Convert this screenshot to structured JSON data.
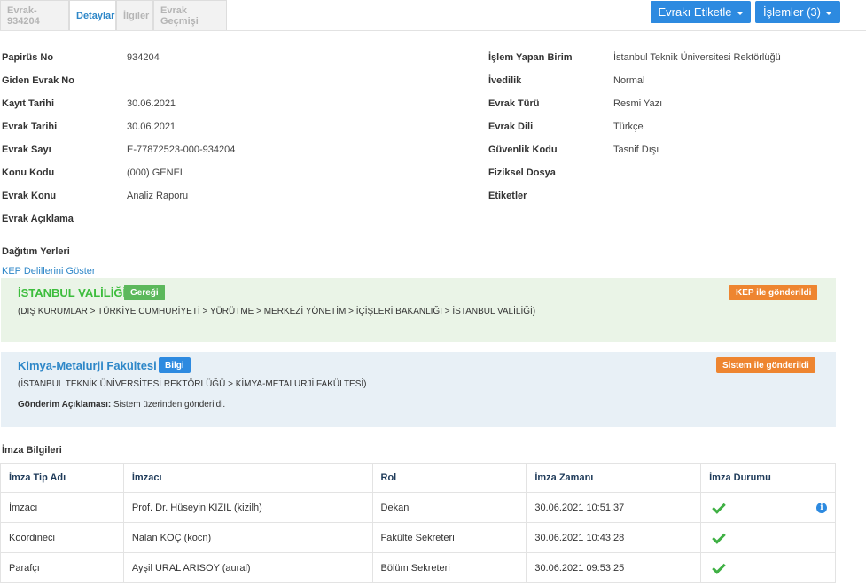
{
  "tabs": [
    "Evrak-934204",
    "Detaylar",
    "İlgiler",
    "Evrak Geçmişi"
  ],
  "buttons": {
    "tag": "Evrakı Etiketle",
    "actions": "İşlemler (3)"
  },
  "details_left": [
    {
      "label": "Papirüs No",
      "value": "934204"
    },
    {
      "label": "Giden Evrak No",
      "value": ""
    },
    {
      "label": "Kayıt Tarihi",
      "value": "30.06.2021"
    },
    {
      "label": "Evrak Tarihi",
      "value": "30.06.2021"
    },
    {
      "label": "Evrak Sayı",
      "value": "E-77872523-000-934204"
    },
    {
      "label": "Konu Kodu",
      "value": "(000) GENEL"
    },
    {
      "label": "Evrak Konu",
      "value": "Analiz Raporu"
    },
    {
      "label": "Evrak Açıklama",
      "value": ""
    }
  ],
  "details_right": [
    {
      "label": "İşlem Yapan Birim",
      "value": "İstanbul Teknik Üniversitesi Rektörlüğü"
    },
    {
      "label": "İvedilik",
      "value": "Normal"
    },
    {
      "label": "Evrak Türü",
      "value": "Resmi Yazı"
    },
    {
      "label": "Evrak Dili",
      "value": "Türkçe"
    },
    {
      "label": "Güvenlik Kodu",
      "value": "Tasnif Dışı"
    },
    {
      "label": "Fiziksel Dosya",
      "value": ""
    },
    {
      "label": "Etiketler",
      "value": ""
    }
  ],
  "distribution": {
    "title": "Dağıtım Yerleri",
    "kep_link": "KEP Delillerini Göster",
    "items": [
      {
        "name": "İSTANBUL VALİLİĞİ",
        "type_badge": "Gereği",
        "status_badge": "KEP ile gönderildi",
        "path": "(DIŞ KURUMLAR > TÜRKİYE CUMHURİYETİ > YÜRÜTME > MERKEZİ YÖNETİM > İÇİŞLERİ BAKANLIĞI > İSTANBUL VALİLİĞİ)"
      },
      {
        "name": "Kimya-Metalurji Fakültesi",
        "type_badge": "Bilgi",
        "status_badge": "Sistem ile gönderildi",
        "path": "(İSTANBUL TEKNİK ÜNİVERSİTESİ REKTÖRLÜĞÜ > KİMYA-METALURJİ FAKÜLTESİ)",
        "note_label": "Gönderim Açıklaması:",
        "note_text": "Sistem üzerinden gönderildi."
      }
    ]
  },
  "signatures": {
    "title": "İmza Bilgileri",
    "columns": [
      "İmza Tip Adı",
      "İmzacı",
      "Rol",
      "İmza Zamanı",
      "İmza Durumu"
    ],
    "rows": [
      {
        "type": "İmzacı",
        "signer": "Prof. Dr. Hüseyin KIZIL (kizilh)",
        "role": "Dekan",
        "time": "30.06.2021 10:51:37",
        "status": "check-icon",
        "info": "i"
      },
      {
        "type": "Koordineci",
        "signer": "Nalan KOÇ (kocn)",
        "role": "Fakülte Sekreteri",
        "time": "30.06.2021 10:43:28",
        "status": "check-icon"
      },
      {
        "type": "Parafçı",
        "signer": "Ayşil URAL ARISOY (aural)",
        "role": "Bölüm Sekreteri",
        "time": "30.06.2021 09:53:25",
        "status": "check-icon"
      }
    ]
  }
}
